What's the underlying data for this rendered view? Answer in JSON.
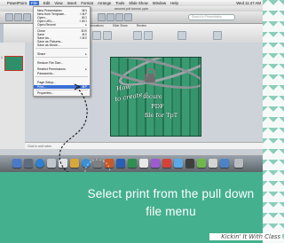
{
  "menubar": {
    "app": "PowerPoint",
    "items": [
      "File",
      "Edit",
      "View",
      "Insert",
      "Format",
      "Arrange",
      "Tools",
      "Slide Show",
      "Window",
      "Help"
    ],
    "clock": "Wed 11:47 AM"
  },
  "window": {
    "title": "secured pdf tutorial .pptx"
  },
  "search": {
    "placeholder": "Search in Presentation"
  },
  "ribbon": {
    "tabs": [
      "Animations",
      "Slide Show",
      "Review"
    ]
  },
  "file_menu": {
    "items": [
      {
        "label": "New Presentation",
        "shortcut": "⌘N"
      },
      {
        "label": "New from Template...",
        "shortcut": "⇧⌘P"
      },
      {
        "label": "Open...",
        "shortcut": "⌘O"
      },
      {
        "label": "Open URL...",
        "shortcut": "⇧⌘O"
      },
      {
        "label": "Open Recent",
        "shortcut": "▸"
      },
      {
        "label": "Close",
        "shortcut": "⌘W"
      },
      {
        "label": "Save",
        "shortcut": "⌘S"
      },
      {
        "label": "Save As...",
        "shortcut": "⇧⌘S"
      },
      {
        "label": "Save as Pictures...",
        "shortcut": ""
      },
      {
        "label": "Save as Movie...",
        "shortcut": ""
      },
      {
        "label": "Share",
        "shortcut": "▸"
      },
      {
        "label": "Reduce File Size...",
        "shortcut": ""
      },
      {
        "label": "Restrict Permissions",
        "shortcut": "▸"
      },
      {
        "label": "Passwords...",
        "shortcut": ""
      },
      {
        "label": "Page Setup...",
        "shortcut": ""
      },
      {
        "label": "Print...",
        "shortcut": "⌘P"
      },
      {
        "label": "Properties...",
        "shortcut": ""
      }
    ],
    "highlighted": "Print..."
  },
  "slide": {
    "line1": "How",
    "line2": "to create a",
    "line3": "secure",
    "line4": "PDF",
    "line5": "file for TpT"
  },
  "notes": {
    "placeholder": "Click to add notes"
  },
  "slide_panel": {
    "number": "1"
  },
  "caption": {
    "text": "Select print from the pull down file menu"
  },
  "watermark": {
    "text": "Kickin' It With Class"
  },
  "colors": {
    "banner": "#45b08d",
    "highlight": "#3b6fd2",
    "chevron": "#7fc9b3"
  }
}
